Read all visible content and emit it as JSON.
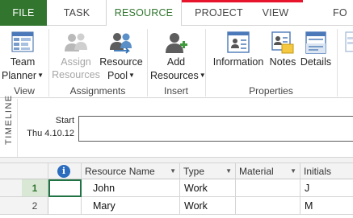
{
  "tabs": {
    "file": "FILE",
    "task": "TASK",
    "resource": "RESOURCE",
    "project": "PROJECT",
    "view": "VIEW",
    "format": "FO"
  },
  "ribbon": {
    "team_planner": {
      "line1": "Team",
      "line2": "Planner"
    },
    "assign_resources": {
      "line1": "Assign",
      "line2": "Resources"
    },
    "resource_pool": {
      "line1": "Resource",
      "line2": "Pool"
    },
    "add_resources": {
      "line1": "Add",
      "line2": "Resources"
    },
    "information": {
      "label": "Information"
    },
    "notes": {
      "label": "Notes"
    },
    "details": {
      "label": "Details"
    },
    "groups": {
      "view": "View",
      "assignments": "Assignments",
      "insert": "Insert",
      "properties": "Properties"
    }
  },
  "timeline": {
    "side_label": "TIMELINE",
    "start_label": "Start",
    "start_date": "Thu 4.10.12"
  },
  "grid": {
    "columns": {
      "resource_name": "Resource Name",
      "type": "Type",
      "material": "Material",
      "initials": "Initials"
    },
    "rows": [
      {
        "num": "1",
        "name": "John",
        "type": "Work",
        "material": "",
        "initials": "J"
      },
      {
        "num": "2",
        "name": "Mary",
        "type": "Work",
        "material": "",
        "initials": "M"
      }
    ]
  },
  "colors": {
    "file_tab": "#31752f",
    "accent": "#31752f",
    "info_icon": "#2b6cbf"
  }
}
